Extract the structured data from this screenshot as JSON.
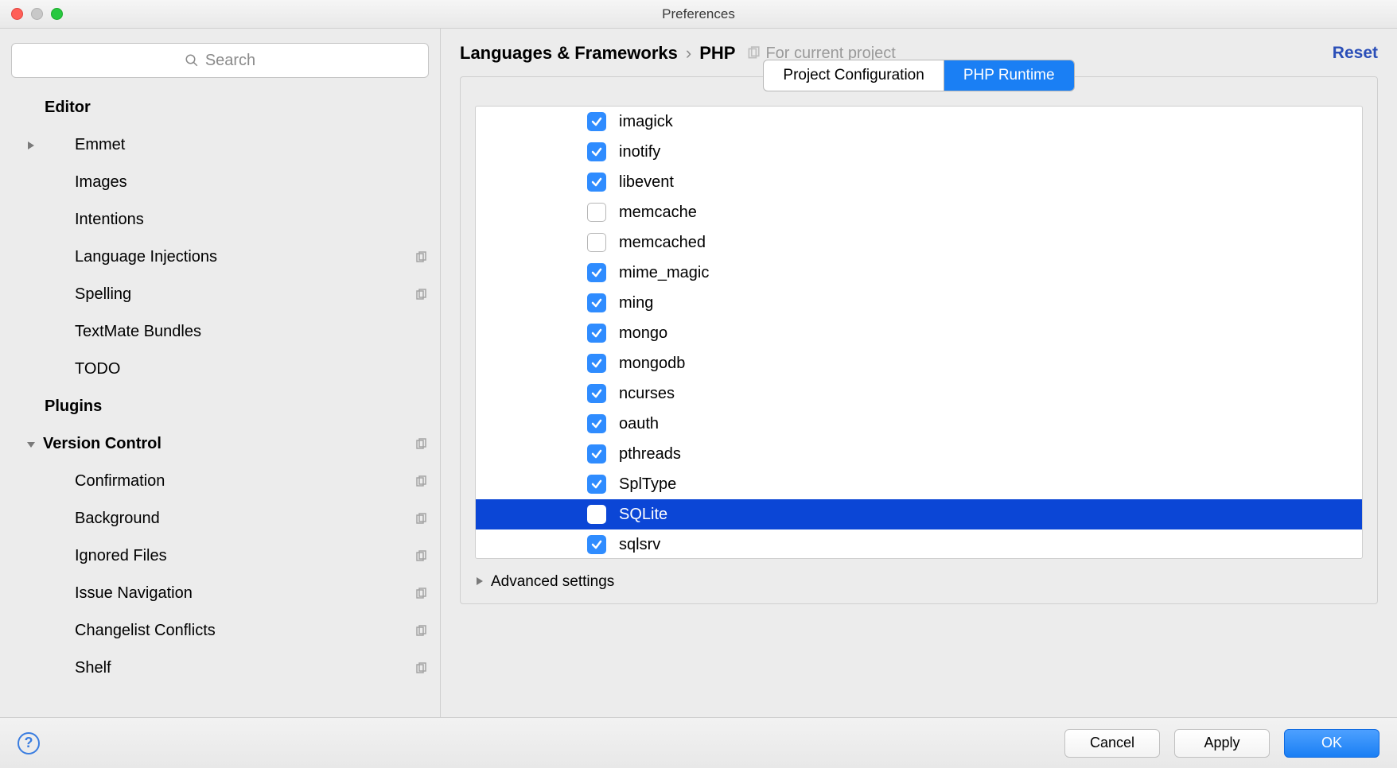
{
  "window": {
    "title": "Preferences"
  },
  "search": {
    "placeholder": "Search"
  },
  "sidebar": {
    "editor_header": "Editor",
    "items": [
      {
        "label": "Emmet",
        "arrow": true
      },
      {
        "label": "Images"
      },
      {
        "label": "Intentions"
      },
      {
        "label": "Language Injections",
        "icon": true
      },
      {
        "label": "Spelling",
        "icon": true
      },
      {
        "label": "TextMate Bundles"
      },
      {
        "label": "TODO"
      }
    ],
    "plugins_header": "Plugins",
    "vc_header": "Version Control",
    "vc_items": [
      {
        "label": "Confirmation",
        "icon": true
      },
      {
        "label": "Background",
        "icon": true
      },
      {
        "label": "Ignored Files",
        "icon": true
      },
      {
        "label": "Issue Navigation",
        "icon": true
      },
      {
        "label": "Changelist Conflicts",
        "icon": true
      },
      {
        "label": "Shelf",
        "icon": true
      }
    ]
  },
  "breadcrumb": {
    "part1": "Languages & Frameworks",
    "part2": "PHP",
    "scope": "For current project",
    "reset": "Reset"
  },
  "tabs": {
    "project": "Project Configuration",
    "runtime": "PHP Runtime"
  },
  "extensions": [
    {
      "name": "imagick",
      "checked": true
    },
    {
      "name": "inotify",
      "checked": true
    },
    {
      "name": "libevent",
      "checked": true
    },
    {
      "name": "memcache",
      "checked": false
    },
    {
      "name": "memcached",
      "checked": false
    },
    {
      "name": "mime_magic",
      "checked": true
    },
    {
      "name": "ming",
      "checked": true
    },
    {
      "name": "mongo",
      "checked": true
    },
    {
      "name": "mongodb",
      "checked": true
    },
    {
      "name": "ncurses",
      "checked": true
    },
    {
      "name": "oauth",
      "checked": true
    },
    {
      "name": "pthreads",
      "checked": true
    },
    {
      "name": "SplType",
      "checked": true
    },
    {
      "name": "SQLite",
      "checked": false,
      "selected": true
    },
    {
      "name": "sqlsrv",
      "checked": true
    }
  ],
  "advanced": "Advanced settings",
  "footer": {
    "cancel": "Cancel",
    "apply": "Apply",
    "ok": "OK"
  }
}
